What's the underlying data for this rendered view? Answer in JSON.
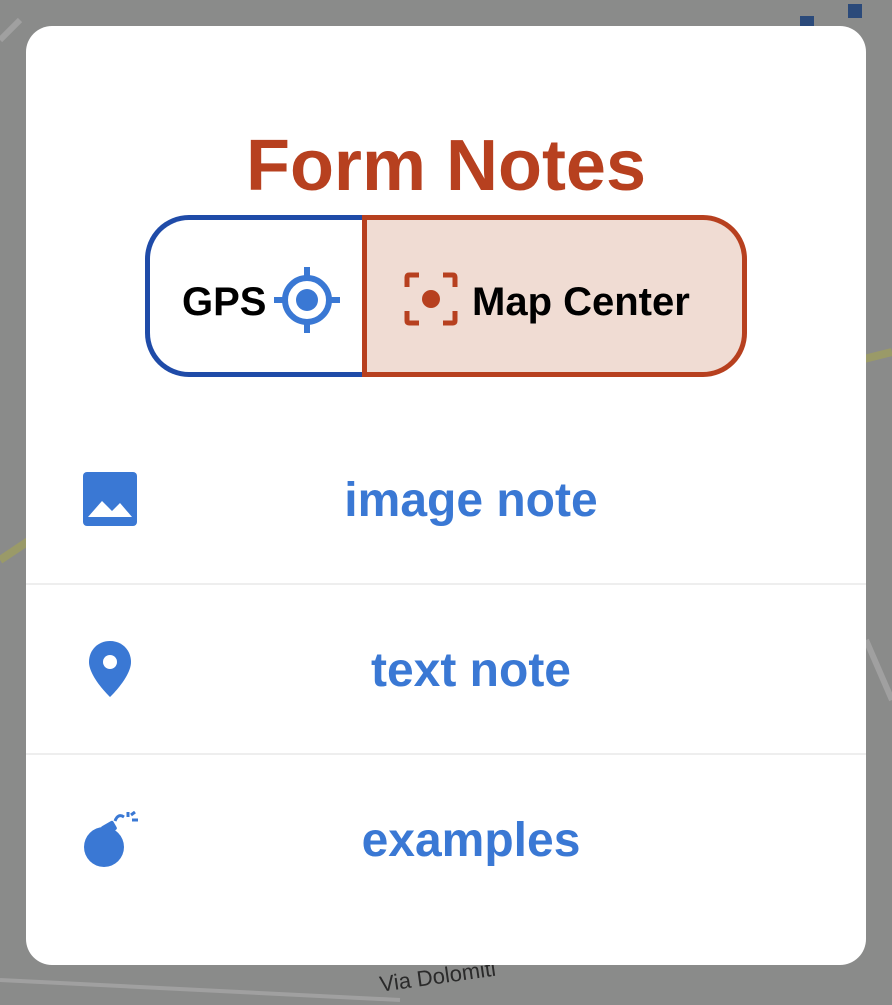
{
  "background": {
    "street_label": "Via Dolomiti"
  },
  "dialog": {
    "title": "Form Notes",
    "toggle": {
      "gps_label": "GPS",
      "map_center_label": "Map Center",
      "selected": "map_center"
    },
    "items": [
      {
        "label": "image note",
        "icon": "image-icon"
      },
      {
        "label": "text note",
        "icon": "map-pin-icon"
      },
      {
        "label": "examples",
        "icon": "bomb-icon"
      }
    ]
  },
  "colors": {
    "title": "#b7401f",
    "gps_border": "#1f4ba8",
    "map_center_border": "#b7401f",
    "map_center_fill": "#f0dcd3",
    "item_text": "#3a78d4",
    "icon": "#3a78d4"
  }
}
